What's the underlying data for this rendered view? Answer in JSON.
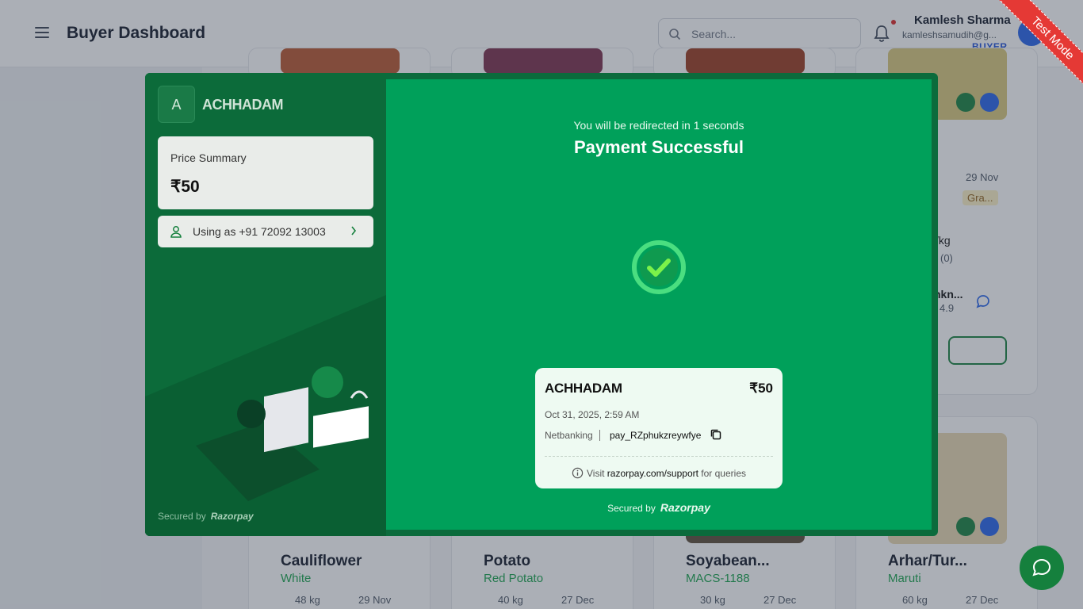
{
  "header": {
    "title": "Buyer Dashboard",
    "search_placeholder": "Search...",
    "user": {
      "name": "Kamlesh Sharma",
      "email": "kamleshsamudih@g...",
      "role": "BUYER"
    },
    "ribbon": "Test Mode"
  },
  "products": [
    {
      "name": "Cauliflower",
      "variety": "White",
      "qty": "48 kg",
      "date": "29 Nov"
    },
    {
      "name": "Potato",
      "variety": "Red Potato",
      "qty": "40 kg",
      "date": "27 Dec"
    },
    {
      "name": "Soyabean...",
      "variety": "MACS-1188",
      "qty": "30 kg",
      "date": "27 Dec"
    },
    {
      "name": "Arhar/Tur...",
      "variety": "Maruti",
      "qty": "60 kg",
      "date": "27 Dec"
    }
  ],
  "partial_card": {
    "date": "29 Nov",
    "grade": "Gra...",
    "unit": "/kg",
    "reviews": "(0)",
    "seller": "nkn...",
    "rating": "4.9"
  },
  "checkout": {
    "merchant_initial": "A",
    "merchant_name": "ACHHADAM",
    "price_summary_label": "Price Summary",
    "price_summary_amount": "₹50",
    "using_as": "Using as +91 72092 13003",
    "secured_by": "Secured by",
    "brand": "Razorpay",
    "redirect_text": "You will be redirected in 1 seconds",
    "status_title": "Payment Successful",
    "receipt": {
      "merchant": "ACHHADAM",
      "amount": "₹50",
      "datetime": "Oct 31, 2025, 2:59 AM",
      "method": "Netbanking",
      "payment_id": "pay_RZphukzreywfye",
      "support_prefix": "Visit",
      "support_link": "razorpay.com/support",
      "support_suffix": "for queries"
    }
  },
  "colors": {
    "brand_green": "#00a05a",
    "panel_green": "#0c6b3a",
    "accent_blue": "#2563eb",
    "alert_red": "#e53935"
  },
  "icons": [
    "menu-icon",
    "search-icon",
    "bell-icon",
    "chevron-down-icon",
    "user-icon",
    "chevron-right-icon",
    "check-circle-icon",
    "copy-icon",
    "info-icon",
    "chat-icon",
    "calendar-icon",
    "box-icon",
    "leaf-icon",
    "verified-icon"
  ]
}
